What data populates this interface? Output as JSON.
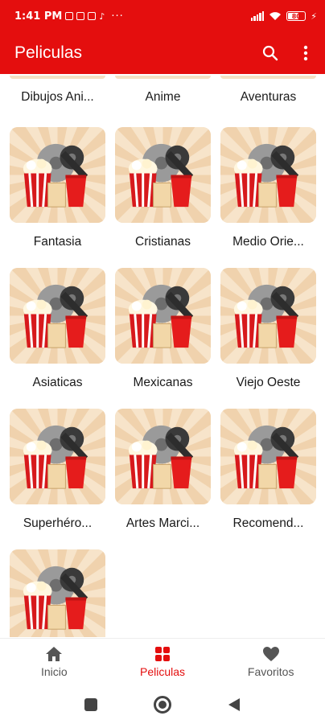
{
  "status_bar": {
    "time": "1:41 PM",
    "more": "···",
    "battery": "80"
  },
  "app_bar": {
    "title": "Peliculas",
    "search_icon": "search-icon",
    "menu_icon": "more-vert-icon"
  },
  "categories_partial": [
    {
      "label": "Dibujos Ani..."
    },
    {
      "label": "Anime"
    },
    {
      "label": "Aventuras"
    }
  ],
  "categories": [
    {
      "label": "Fantasia"
    },
    {
      "label": "Cristianas"
    },
    {
      "label": "Medio Orie..."
    },
    {
      "label": "Asiaticas"
    },
    {
      "label": "Mexicanas"
    },
    {
      "label": "Viejo Oeste"
    },
    {
      "label": "Superhéro..."
    },
    {
      "label": "Artes Marci..."
    },
    {
      "label": "Recomend..."
    },
    {
      "label": ""
    }
  ],
  "bottom_nav": {
    "items": [
      {
        "label": "Inicio",
        "icon": "home-icon"
      },
      {
        "label": "Peliculas",
        "icon": "grid-icon",
        "active": true
      },
      {
        "label": "Favoritos",
        "icon": "heart-icon"
      }
    ]
  },
  "colors": {
    "primary": "#e40e0e",
    "tile_bg": "#f5e0c4",
    "popcorn_red": "#d7191c"
  }
}
